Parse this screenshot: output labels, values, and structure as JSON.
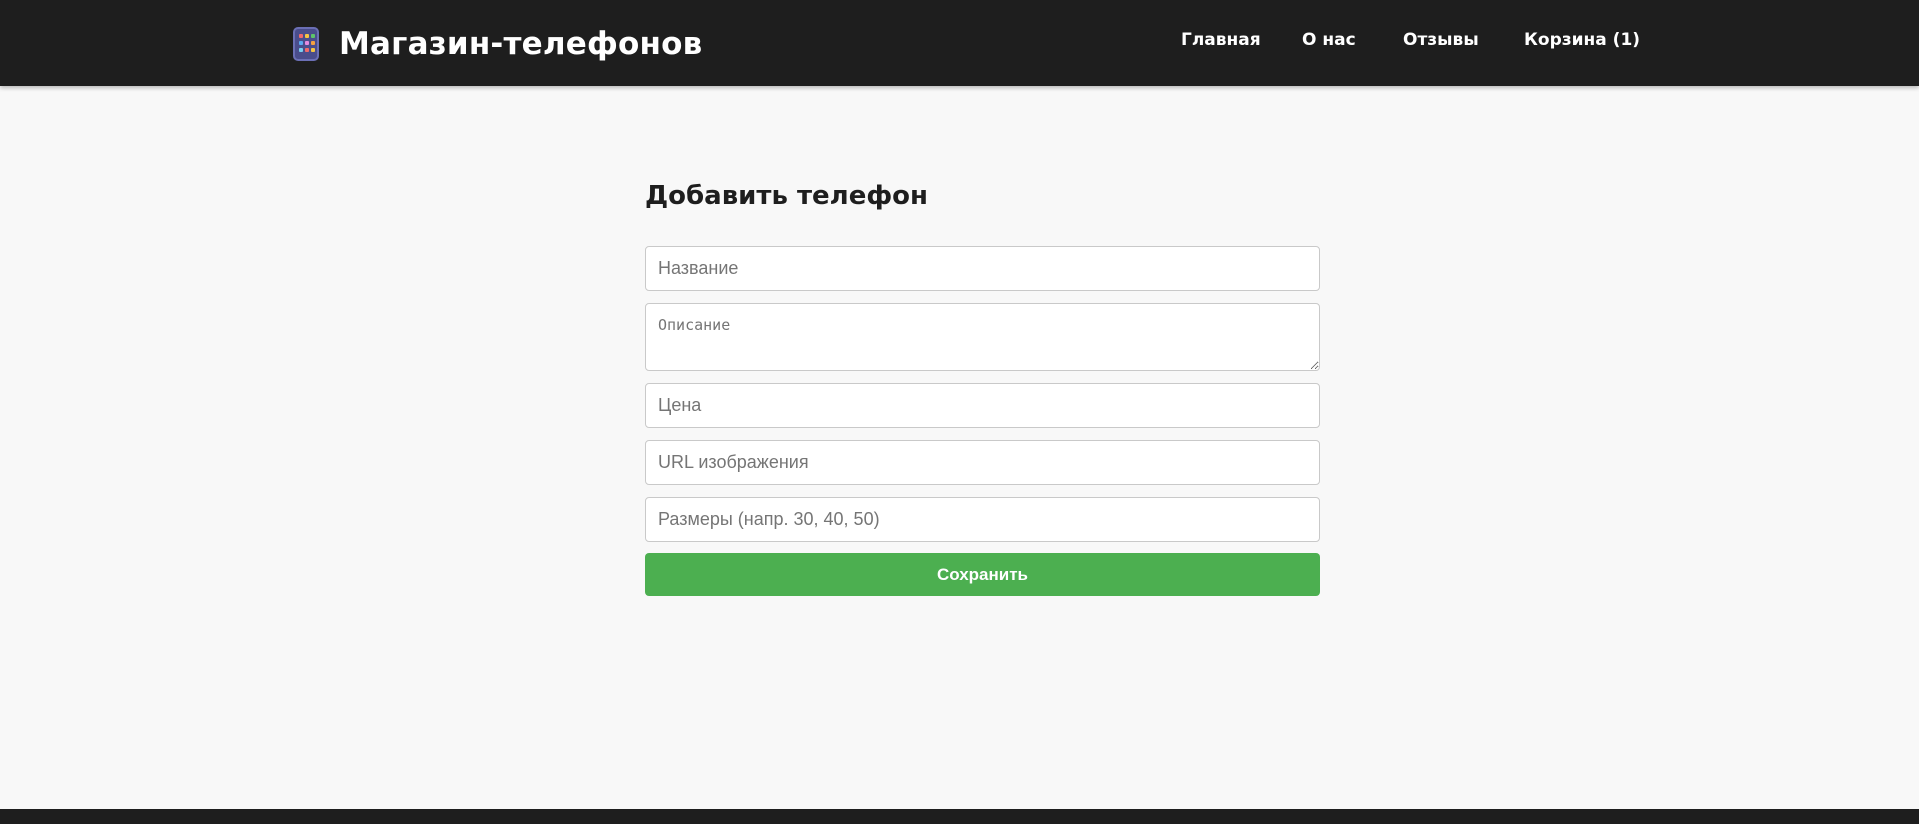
{
  "header": {
    "brand_title": "Магазин-телефонов",
    "brand_icon": "mobile-phone-icon",
    "nav": [
      {
        "label": "Главная"
      },
      {
        "label": "О нас"
      },
      {
        "label": "Отзывы"
      },
      {
        "label": "Корзина (1)"
      }
    ]
  },
  "form": {
    "title": "Добавить телефон",
    "name_placeholder": "Название",
    "description_placeholder": "Описание",
    "price_placeholder": "Цена",
    "image_url_placeholder": "URL изображения",
    "sizes_placeholder": "Размеры (напр. 30, 40, 50)",
    "save_label": "Сохранить"
  },
  "colors": {
    "header_bg": "#1e1e1e",
    "page_bg": "#f8f8f8",
    "accent_button": "#4caf50"
  }
}
